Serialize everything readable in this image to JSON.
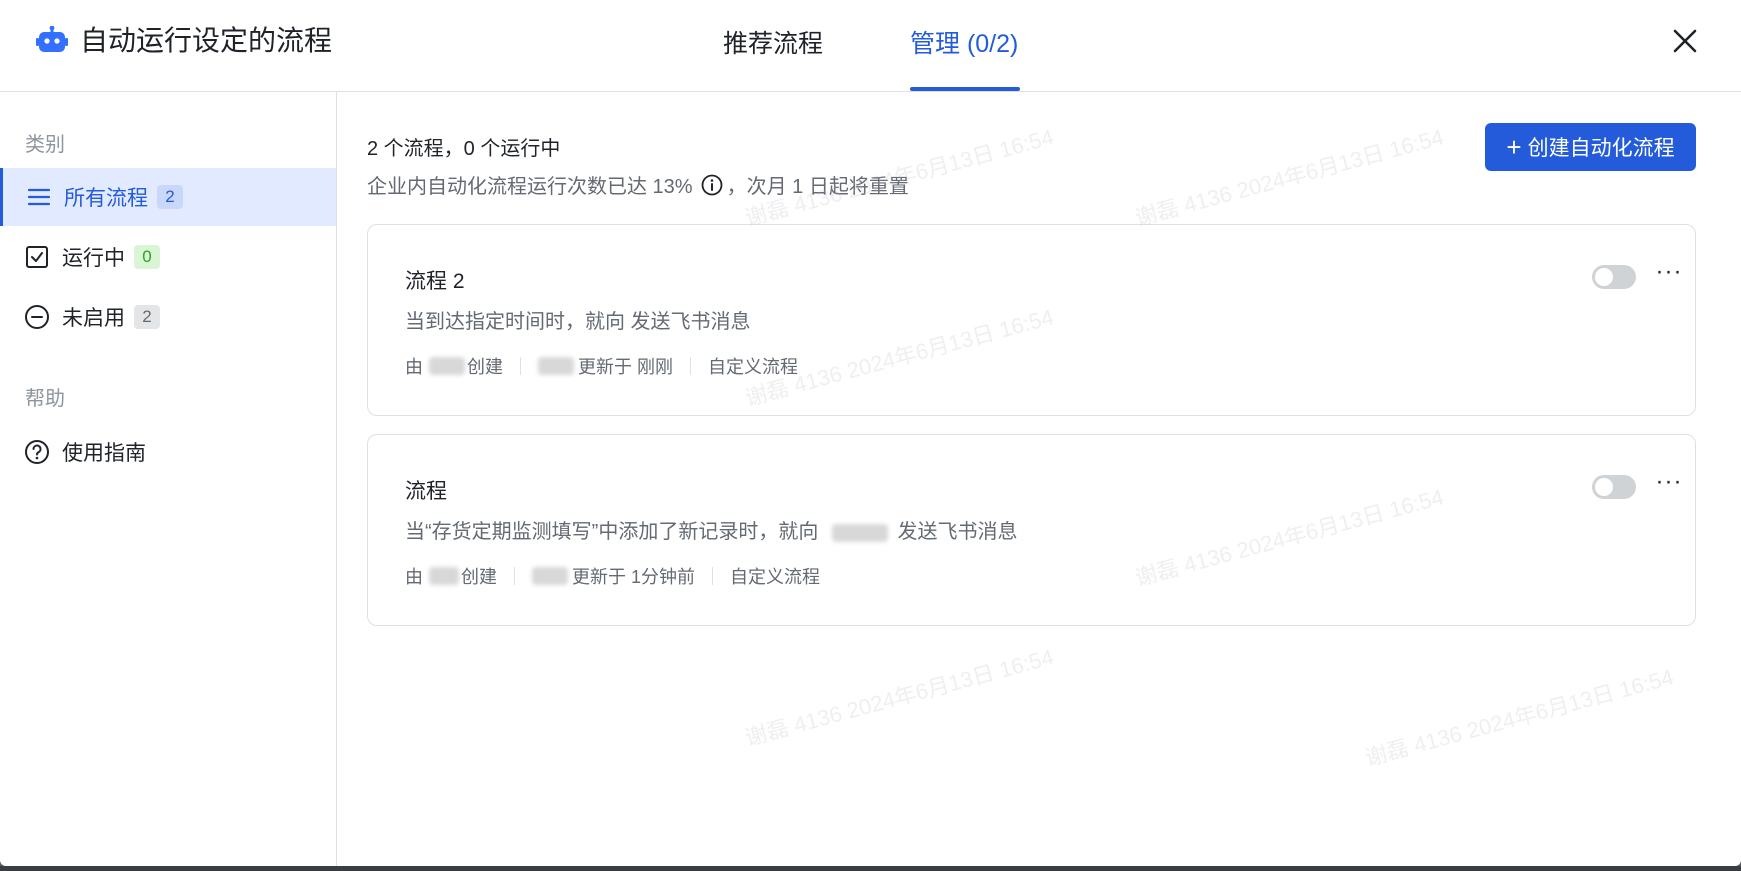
{
  "header": {
    "title": "自动运行设定的流程",
    "tabs": [
      {
        "label": "推荐流程"
      },
      {
        "label": "管理 (0/2)"
      }
    ]
  },
  "sidebar": {
    "section_category": "类别",
    "items": [
      {
        "label": "所有流程",
        "count": "2"
      },
      {
        "label": "运行中",
        "count": "0"
      },
      {
        "label": "未启用",
        "count": "2"
      }
    ],
    "section_help": "帮助",
    "help_item": "使用指南"
  },
  "main": {
    "summary": "2 个流程，0 个运行中",
    "quota_prefix": "企业内自动化流程运行次数已达 13%",
    "quota_suffix": "，次月 1 日起将重置",
    "create_button": "创建自动化流程",
    "flows": [
      {
        "title": "流程 2",
        "description": "当到达指定时间时，就向 发送飞书消息",
        "by": "由",
        "created": "创建",
        "updated": "更新于 刚刚",
        "type": "自定义流程"
      },
      {
        "title": "流程",
        "description_prefix": "当“存货定期监测填写”中添加了新记录时，就向",
        "description_suffix": "发送飞书消息",
        "by": "由",
        "created": "创建",
        "updated": "更新于 1分钟前",
        "type": "自定义流程"
      }
    ]
  },
  "watermark": "谢磊 4136 2024年6月13日 16:54",
  "colors": {
    "accent": "#245bdb",
    "active_bg": "#e1eaff",
    "running_badge": "#2ea121"
  }
}
